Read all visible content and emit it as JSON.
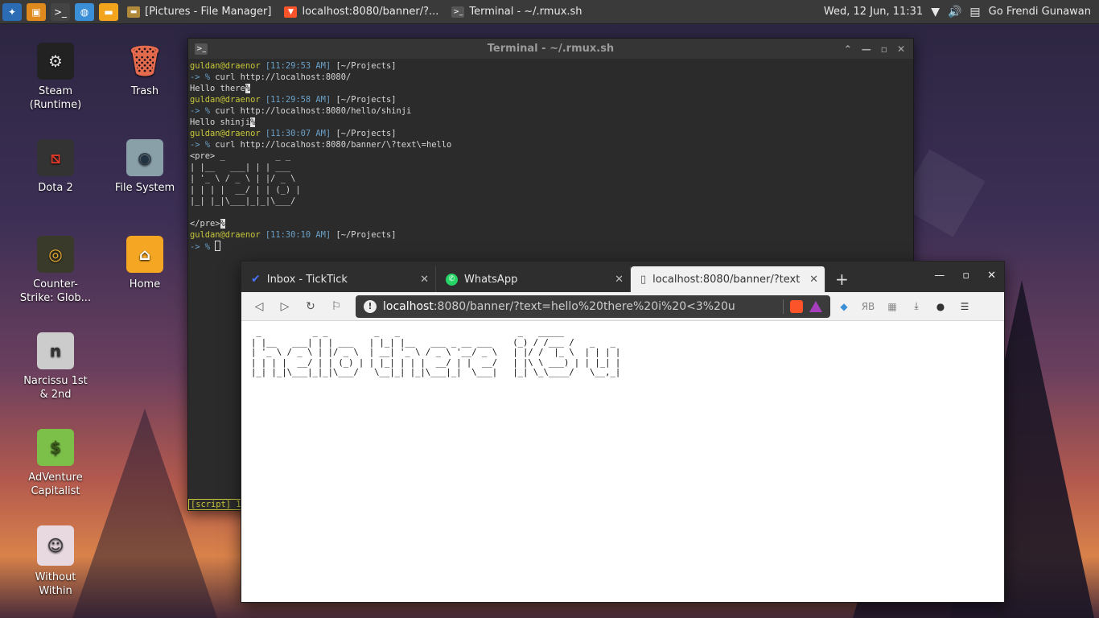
{
  "panel": {
    "tasks": [
      {
        "label": "[Pictures - File Manager]",
        "icon": "folder-icon"
      },
      {
        "label": "localhost:8080/banner/?...",
        "icon": "brave-icon"
      },
      {
        "label": "Terminal - ~/.rmux.sh",
        "icon": "terminal-icon"
      }
    ],
    "clock": "Wed, 12 Jun, 11:31",
    "user": "Go Frendi Gunawan"
  },
  "desktop": {
    "icons": [
      {
        "label": "Steam\n(Runtime)"
      },
      {
        "label": "Trash"
      },
      {
        "label": "Dota 2"
      },
      {
        "label": "File System"
      },
      {
        "label": "Counter-\nStrike: Glob..."
      },
      {
        "label": "Home"
      },
      {
        "label": "Narcissu 1st\n& 2nd"
      },
      {
        "label": "AdVenture\nCapitalist"
      },
      {
        "label": "Without\nWithin"
      }
    ]
  },
  "terminal": {
    "title": "Terminal - ~/.rmux.sh",
    "user": "guldan@draenor",
    "cwd": "[~/Projects]",
    "prompt": "-> %",
    "entries": [
      {
        "time": "[11:29:53 AM]",
        "cmd": "curl http://localhost:8080/",
        "output": "Hello there"
      },
      {
        "time": "[11:29:58 AM]",
        "cmd": "curl http://localhost:8080/hello/shinji",
        "output": "Hello shinji"
      },
      {
        "time": "[11:30:07 AM]",
        "cmd": "curl http://localhost:8080/banner/\\?text\\=hello"
      }
    ],
    "banner_open": "<pre>",
    "banner": [
      " _          _ _       ",
      "| |__   ___| | | ___  ",
      "| '_ \\ / _ \\ | |/ _ \\ ",
      "| | | |  __/ | | (_) |",
      "|_| |_|\\___|_|_|\\___/ "
    ],
    "banner_close": "</pre>",
    "last_time": "[11:30:10 AM]",
    "status": "[script] 1"
  },
  "browser": {
    "tabs": [
      {
        "label": "Inbox - TickTick",
        "icon": "ticktick-icon"
      },
      {
        "label": "WhatsApp",
        "icon": "whatsapp-icon"
      },
      {
        "label": "localhost:8080/banner/?text",
        "icon": "page-icon"
      }
    ],
    "url_host": "localhost",
    "url_rest": ":8080/banner/?text=hello%20there%20i%20<3%20u",
    "ascii": [
      " _          _ _         _   _                       _   _____                ",
      "| |__   ___| | | ___   | |_| |__   ___ _ __ ___    (_) / /___ /   _   _ ",
      "| '_ \\ / _ \\ | |/ _ \\  | __| '_ \\ / _ \\ '__/ _ \\   | |/ /  |_ \\  | | | |",
      "| | | |  __/ | | (_) | | |_| | | |  __/ | |  __/   | |\\ \\ ___) | | |_| |",
      "|_| |_|\\___|_|_|\\___/   \\__|_| |_|\\___|_|  \\___|   |_| \\_\\____/   \\__,_|"
    ]
  }
}
